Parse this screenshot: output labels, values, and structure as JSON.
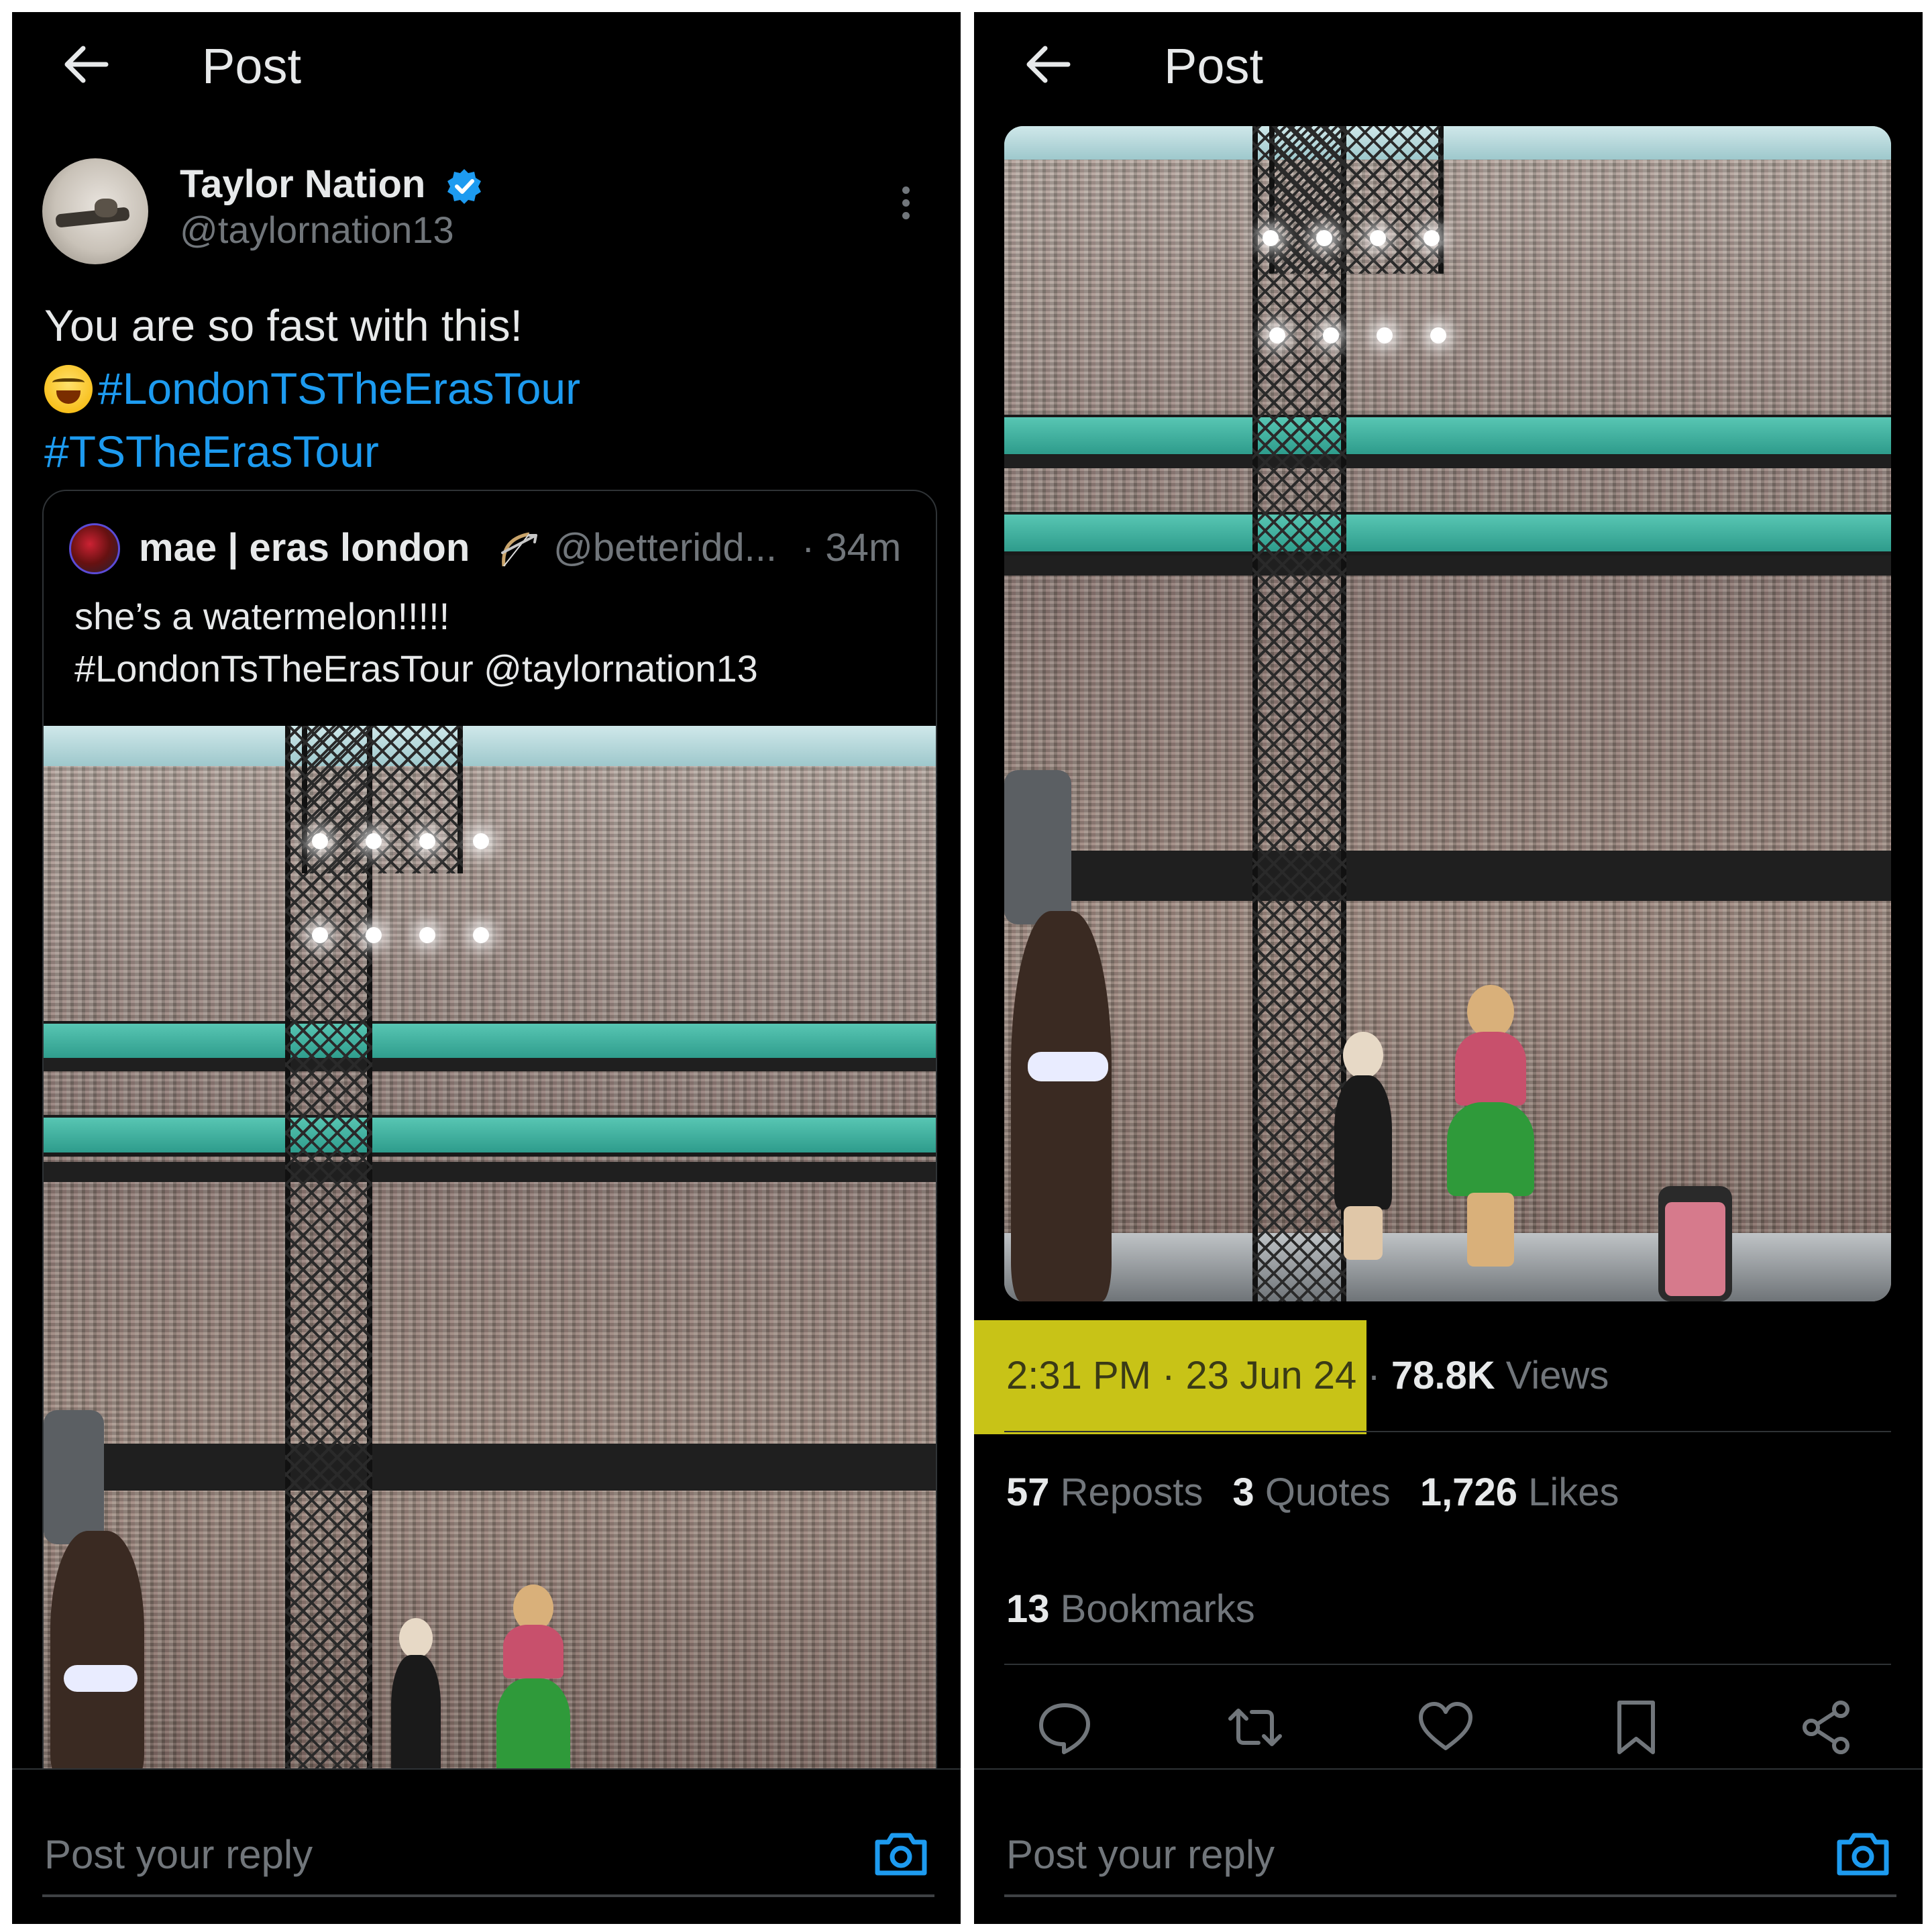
{
  "left_panel": {
    "header": {
      "title": "Post"
    },
    "post": {
      "author_name": "Taylor Nation",
      "author_handle": "@taylornation13",
      "text_line1": "You are so fast with this!",
      "emoji": "grinning-squinting-face",
      "hashtag1": "#LondonTSTheErasTour",
      "hashtag2": "#TSTheErasTour"
    },
    "quoted_post": {
      "author_name": "mae | eras london",
      "author_handle": "@betteridd...",
      "time": "· 34m",
      "text_line1": "she’s a watermelon!!!!!",
      "text_line2": "#LondonTsTheErasTour @taylornation13"
    },
    "reply": {
      "placeholder": "Post your reply"
    }
  },
  "right_panel": {
    "header": {
      "title": "Post"
    },
    "timestamp": "2:31 PM · 23 Jun 24",
    "separator": " · ",
    "views_count": "78.8K",
    "views_label": "Views",
    "stats": [
      {
        "count": "57",
        "label": "Reposts"
      },
      {
        "count": "3",
        "label": "Quotes"
      },
      {
        "count": "1,726",
        "label": "Likes"
      }
    ],
    "bookmarks": {
      "count": "13",
      "label": "Bookmarks"
    },
    "actions": [
      "reply-icon",
      "repost-icon",
      "like-icon",
      "bookmark-icon",
      "share-icon"
    ],
    "reply": {
      "placeholder": "Post your reply"
    }
  },
  "colors": {
    "background": "#000000",
    "text": "#e7e9ea",
    "secondary_text": "#71767b",
    "accent": "#1d9bf0",
    "highlight": "#c8c317",
    "divider": "#2f3336"
  }
}
